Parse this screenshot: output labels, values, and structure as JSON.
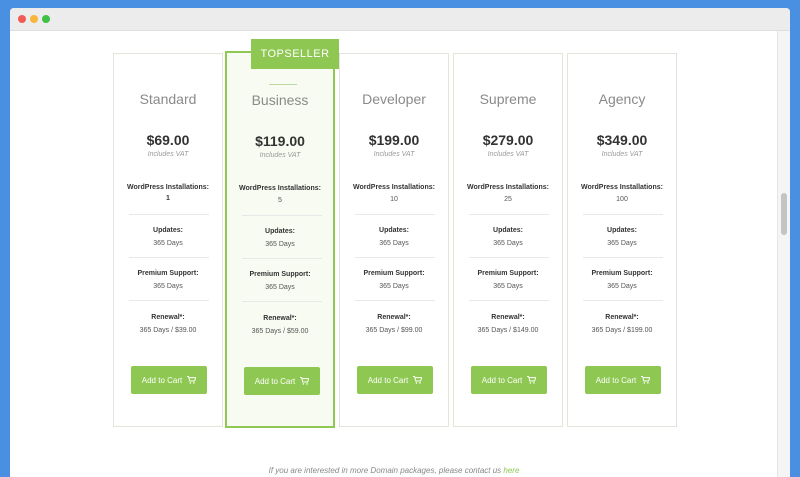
{
  "plans": [
    {
      "name": "Standard",
      "price": "$69.00",
      "vat": "Includes VAT",
      "features": [
        {
          "label": "WordPress Installations:",
          "value": "1"
        },
        {
          "label": "Updates:",
          "value": "365 Days"
        },
        {
          "label": "Premium Support:",
          "value": "365 Days"
        },
        {
          "label": "Renewal*:",
          "value": "365 Days / $39.00"
        }
      ],
      "button": "Add to Cart"
    },
    {
      "name": "Business",
      "price": "$119.00",
      "vat": "Includes VAT",
      "badge": "TOPSELLER",
      "features": [
        {
          "label": "WordPress Installations:",
          "value": "5"
        },
        {
          "label": "Updates:",
          "value": "365 Days"
        },
        {
          "label": "Premium Support:",
          "value": "365 Days"
        },
        {
          "label": "Renewal*:",
          "value": "365 Days / $59.00"
        }
      ],
      "button": "Add to Cart"
    },
    {
      "name": "Developer",
      "price": "$199.00",
      "vat": "Includes VAT",
      "features": [
        {
          "label": "WordPress Installations:",
          "value": "10"
        },
        {
          "label": "Updates:",
          "value": "365 Days"
        },
        {
          "label": "Premium Support:",
          "value": "365 Days"
        },
        {
          "label": "Renewal*:",
          "value": "365 Days / $99.00"
        }
      ],
      "button": "Add to Cart"
    },
    {
      "name": "Supreme",
      "price": "$279.00",
      "vat": "Includes VAT",
      "features": [
        {
          "label": "WordPress Installations:",
          "value": "25"
        },
        {
          "label": "Updates:",
          "value": "365 Days"
        },
        {
          "label": "Premium Support:",
          "value": "365 Days"
        },
        {
          "label": "Renewal*:",
          "value": "365 Days / $149.00"
        }
      ],
      "button": "Add to Cart"
    },
    {
      "name": "Agency",
      "price": "$349.00",
      "vat": "Includes VAT",
      "features": [
        {
          "label": "WordPress Installations:",
          "value": "100"
        },
        {
          "label": "Updates:",
          "value": "365 Days"
        },
        {
          "label": "Premium Support:",
          "value": "365 Days"
        },
        {
          "label": "Renewal*:",
          "value": "365 Days / $199.00"
        }
      ],
      "button": "Add to Cart"
    }
  ],
  "footer": {
    "text": "If you are interested in more Domain packages, please contact us ",
    "link": "here"
  },
  "colors": {
    "accent": "#8ec752",
    "background": "#4a90e2"
  }
}
